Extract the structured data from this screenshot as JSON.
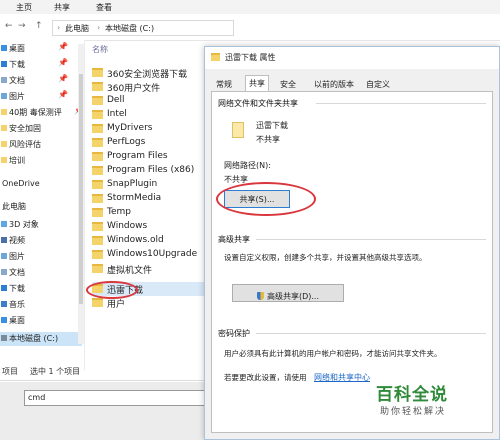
{
  "ribbon": {
    "home": "主页",
    "share": "共享",
    "view": "查看"
  },
  "address": {
    "back": "←",
    "forward": "→",
    "up": "↑",
    "seg1": "此电脑",
    "seg2": "本地磁盘 (C:)",
    "sep": "›"
  },
  "nav": [
    {
      "label": "桌面",
      "pin": "📌"
    },
    {
      "label": "下载",
      "pin": "📌"
    },
    {
      "label": "文档",
      "pin": "📌"
    },
    {
      "label": "图片",
      "pin": "📌"
    },
    {
      "label": "40期 毒保测评",
      "pin": "📌"
    },
    {
      "label": "安全加固",
      "pin": ""
    },
    {
      "label": "风险评估",
      "pin": ""
    },
    {
      "label": "培训",
      "pin": ""
    },
    {
      "label": "OneDrive",
      "pin": ""
    },
    {
      "label": "此电脑",
      "pin": ""
    },
    {
      "label": "3D 对象",
      "pin": ""
    },
    {
      "label": "视频",
      "pin": ""
    },
    {
      "label": "图片",
      "pin": ""
    },
    {
      "label": "文档",
      "pin": ""
    },
    {
      "label": "下载",
      "pin": ""
    },
    {
      "label": "音乐",
      "pin": ""
    },
    {
      "label": "桌面",
      "pin": ""
    },
    {
      "label": "本地磁盘 (C:)",
      "pin": ""
    }
  ],
  "list": {
    "header": "名称",
    "files": [
      "360安全浏览器下载",
      "360用户文件",
      "Dell",
      "Intel",
      "MyDrivers",
      "PerfLogs",
      "Program Files",
      "Program Files (x86)",
      "SnapPlugin",
      "StormMedia",
      "Temp",
      "Windows",
      "Windows.old",
      "Windows10Upgrade",
      "虚拟机文件",
      "迅雷下载",
      "用户"
    ]
  },
  "status": {
    "count": "项目",
    "selected": "选中 1 个项目"
  },
  "cmd": {
    "value": "cmd"
  },
  "dialog": {
    "title": "迅雷下载 属性",
    "tabs": [
      "常规",
      "共享",
      "安全",
      "以前的版本",
      "自定义"
    ],
    "net_section": "网络文件和文件夹共享",
    "folder_name": "迅雷下载",
    "folder_state": "不共享",
    "net_path_label": "网络路径(N):",
    "net_path_value": "不共享",
    "share_button": "共享(S)...",
    "adv_section": "高级共享",
    "adv_desc": "设置自定义权限，创建多个共享，并设置其他高级共享选项。",
    "adv_button": "高级共享(D)...",
    "pwd_section": "密码保护",
    "pwd_desc": "用户必须具有此计算机的用户帐户和密码，才能访问共享文件夹。",
    "pwd_change_prefix": "若要更改此设置，请使用",
    "pwd_link": "网络和共享中心"
  },
  "watermark": {
    "title": "百科全说",
    "subtitle": "助你轻松解决"
  },
  "colors": {
    "accent": "#2f7dd1",
    "annotation": "#d9363e",
    "folder": "#f5d36b",
    "selection": "#cce4f7",
    "watermark": "#2f8a3a"
  }
}
